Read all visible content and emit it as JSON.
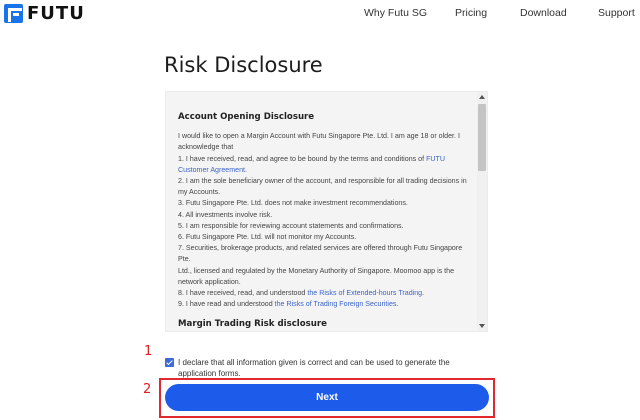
{
  "header": {
    "logo_text": "FUTU",
    "nav": [
      "Why Futu SG",
      "Pricing",
      "Download",
      "Support"
    ]
  },
  "page_title": "Risk Disclosure",
  "disclosure": {
    "heading": "Account Opening Disclosure",
    "intro": "I would like to open a Margin Account with Futu Singapore Pte. Ltd. I am age 18 or older. I acknowledge that",
    "item1_prefix": "1. I have received, read, and agree to be bound by the terms and conditions of ",
    "item1_link": "FUTU Customer Agreement",
    "item1_suffix": ".",
    "item2": "2. I am the sole beneficiary owner of the account, and responsible for all trading decisions in my Accounts.",
    "item3": "3. Futu Singapore Pte. Ltd. does not make investment recommendations.",
    "item4": "4. All investments involve risk.",
    "item5": "5. I am responsible for reviewing account statements and confirmations.",
    "item6": "6. Futu Singapore Pte. Ltd. will not monitor my Accounts.",
    "item7": "7. Securities, brokerage products, and related services are offered through Futu Singapore Pte.",
    "item7b": "Ltd., licensed and regulated by the Monetary Authority of Singapore. Moomoo app is the network application.",
    "item8_prefix": "8. I have received, read, and understood ",
    "item8_link": "the Risks of Extended-hours Trading",
    "item8_suffix": ".",
    "item9_prefix": "9. I have read and understood ",
    "item9_link": "the Risks of Trading Foreign Securities",
    "item9_suffix": ".",
    "heading2": "Margin Trading Risk disclosure"
  },
  "markers": [
    "1",
    "2"
  ],
  "declaration": {
    "checked": true,
    "text": "I declare that all information given is correct and can be used to generate the application forms."
  },
  "next_button": {
    "label": "Next"
  },
  "colors": {
    "brand": "#1a73e8",
    "button": "#1d5bea",
    "link": "#3b63c7",
    "annotation": "#e02020"
  }
}
